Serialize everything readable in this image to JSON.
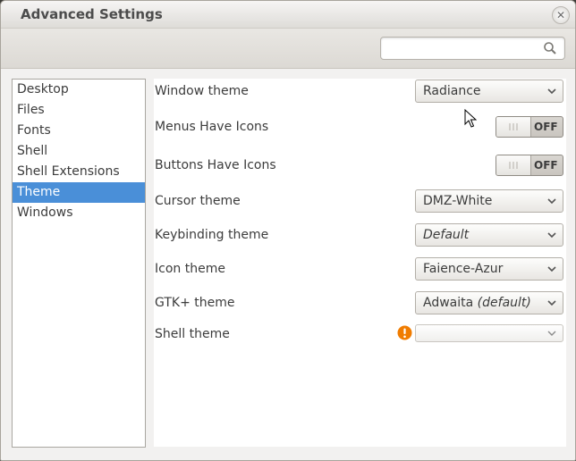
{
  "window": {
    "title": "Advanced Settings"
  },
  "search": {
    "placeholder": "",
    "value": ""
  },
  "sidebar": {
    "items": [
      {
        "label": "Desktop"
      },
      {
        "label": "Files"
      },
      {
        "label": "Fonts"
      },
      {
        "label": "Shell"
      },
      {
        "label": "Shell Extensions"
      },
      {
        "label": "Theme",
        "selected": true
      },
      {
        "label": "Windows"
      }
    ]
  },
  "settings": {
    "window_theme": {
      "label": "Window theme",
      "value": "Radiance"
    },
    "menus_have_icons": {
      "label": "Menus Have Icons",
      "state": "OFF"
    },
    "buttons_have_icons": {
      "label": "Buttons Have Icons",
      "state": "OFF"
    },
    "cursor_theme": {
      "label": "Cursor theme",
      "value": "DMZ-White"
    },
    "keybinding_theme": {
      "label": "Keybinding theme",
      "value": "Default"
    },
    "icon_theme": {
      "label": "Icon theme",
      "value": "Faience-Azur"
    },
    "gtk_theme": {
      "label": "GTK+ theme",
      "value": "Adwaita",
      "suffix": "(default)"
    },
    "shell_theme": {
      "label": "Shell theme",
      "value": ""
    }
  },
  "colors": {
    "selection": "#4a8fd8",
    "warning": "#f07c00"
  }
}
